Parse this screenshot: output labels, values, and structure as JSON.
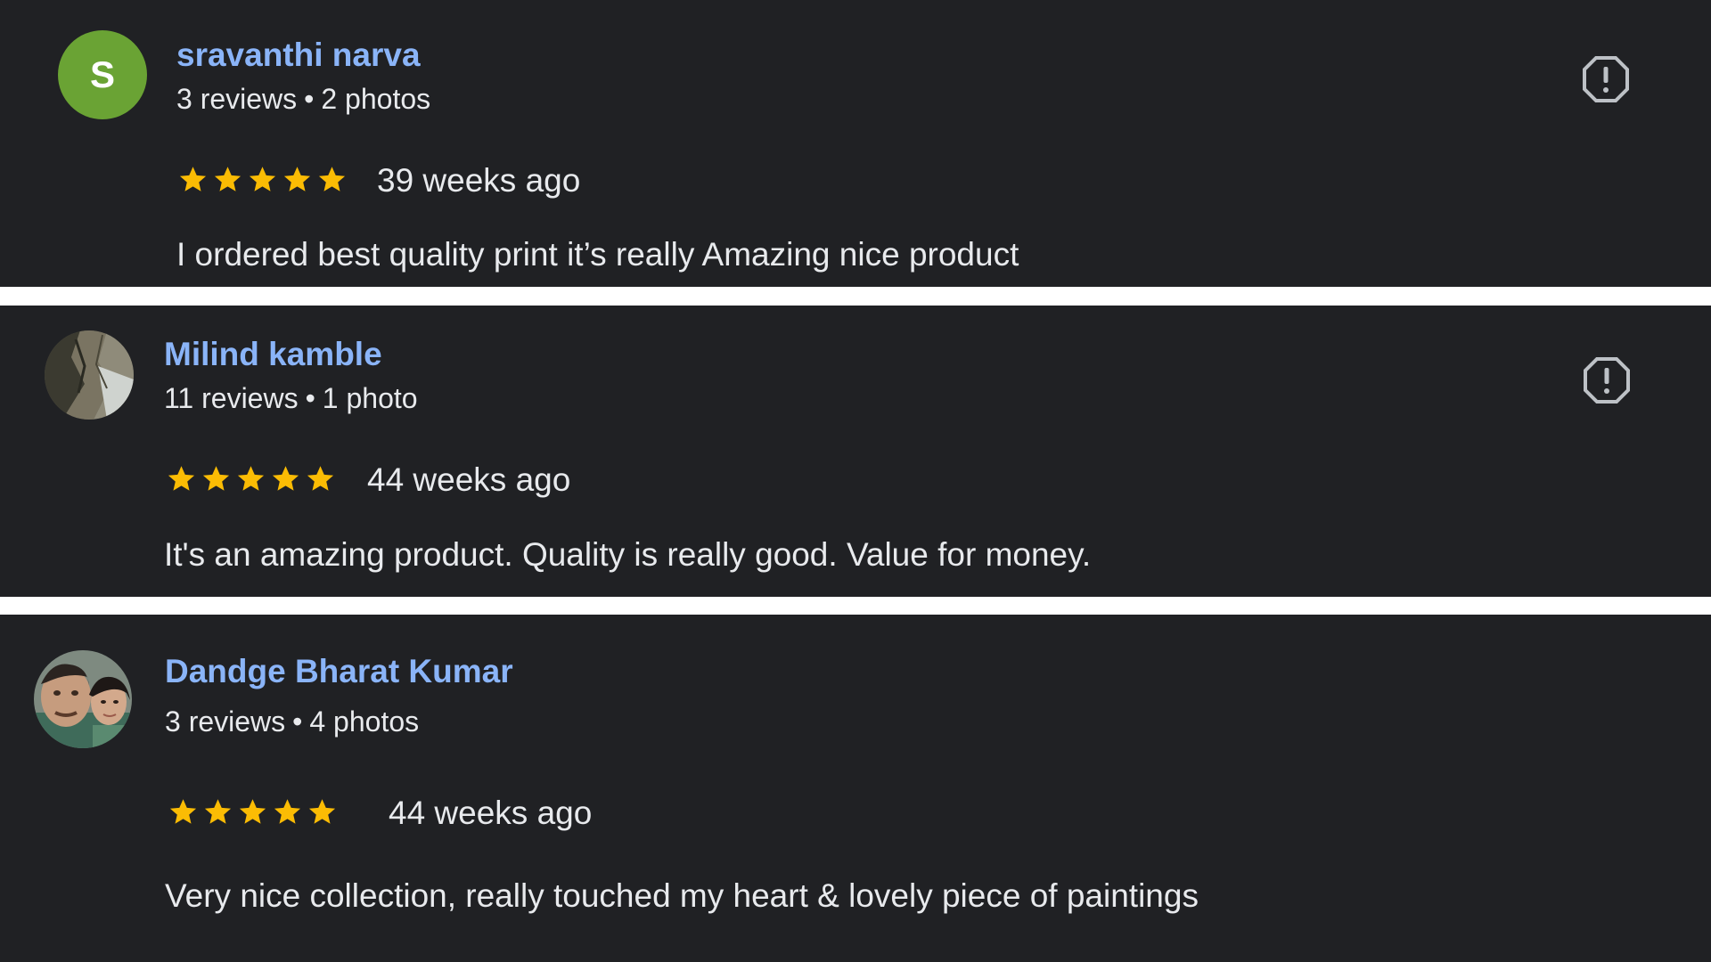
{
  "colors": {
    "card_background": "#202124",
    "divider": "#ffffff",
    "name": "#8ab4f8",
    "text": "#e8eaed",
    "star": "#fbbc04",
    "avatar_green": "#6aa334"
  },
  "reviews": [
    {
      "avatar": {
        "type": "letter",
        "letter": "S"
      },
      "name": "sravanthi narva",
      "reviews_count": "3 reviews",
      "separator": "•",
      "photos_count": "2 photos",
      "rating": 5,
      "time_ago": "39 weeks ago",
      "text": "I ordered best quality print it’s really Amazing nice product",
      "flag_icon": "report-flag-icon"
    },
    {
      "avatar": {
        "type": "photo",
        "description_icon": "rock-photo-avatar"
      },
      "name": "Milind kamble",
      "reviews_count": "11 reviews",
      "separator": "•",
      "photos_count": "1 photo",
      "rating": 5,
      "time_ago": "44 weeks ago",
      "text": "It's an amazing product. Quality is really good. Value for money.",
      "flag_icon": "report-flag-icon"
    },
    {
      "avatar": {
        "type": "photo",
        "description_icon": "people-photo-avatar"
      },
      "name": "Dandge Bharat Kumar",
      "reviews_count": "3 reviews",
      "separator": "•",
      "photos_count": "4 photos",
      "rating": 5,
      "time_ago": "44 weeks ago",
      "text": "Very nice collection, really touched my heart & lovely piece of paintings",
      "flag_icon": null
    }
  ]
}
